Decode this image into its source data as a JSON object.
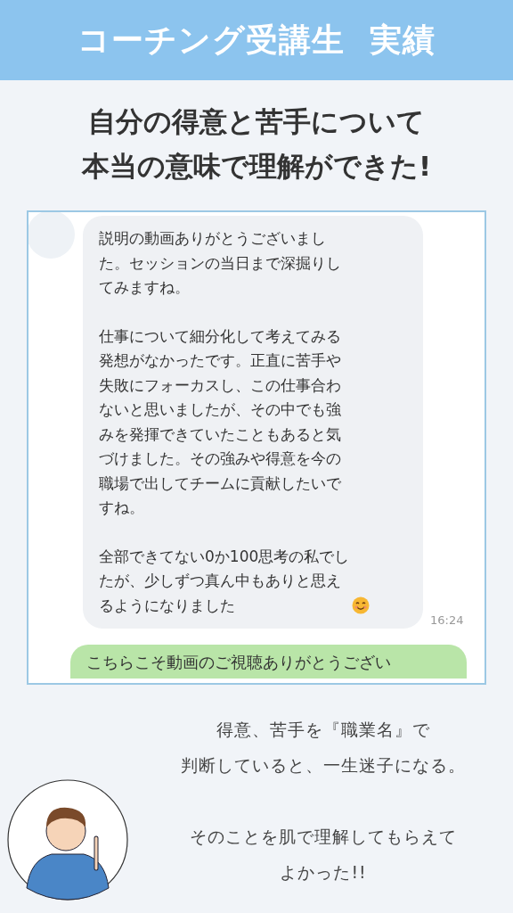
{
  "header": {
    "title": "コーチング受講生  実績"
  },
  "headline": [
    "自分の得意と苦手について",
    "本当の意味で理解ができた!"
  ],
  "chat": {
    "received": {
      "paragraphs": [
        "説明の動画ありがとうございました。セッションの当日まで深掘りしてみますね。",
        "仕事について細分化して考えてみる発想がなかったです。正直に苦手や失敗にフォーカスし、この仕事合わないと思いましたが、その中でも強みを発揮できていたこともあると気づけました。その強みや得意を今の職場で出してチームに貢献したいですね。",
        "全部できてない0か100思考の私でしたが、少しずつ真ん中もありと思えるようになりました"
      ],
      "time": "16:24"
    },
    "sent": {
      "text": "こちらこそ動画のご視聴ありがとうござい"
    }
  },
  "comment": [
    [
      "得意、苦手を『職業名』で",
      "判断していると、一生迷子になる。"
    ],
    [
      "そのことを肌で理解してもらえて",
      "よかった!!"
    ]
  ]
}
